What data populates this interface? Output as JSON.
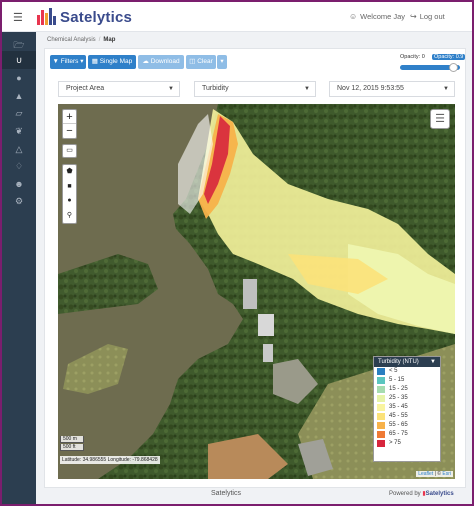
{
  "app": {
    "brand": "Satelytics",
    "brand_colors": [
      "#e8364f",
      "#f0a030",
      "#3a4b8c"
    ]
  },
  "header": {
    "welcome": "Welcome Jay",
    "logout": "Log out"
  },
  "sidebar": {
    "items": [
      {
        "icon": "folder-icon"
      },
      {
        "icon": "magnet-icon",
        "active": true
      },
      {
        "icon": "drop-icon"
      },
      {
        "icon": "warning-icon"
      },
      {
        "icon": "flask-icon"
      },
      {
        "icon": "leaf-icon"
      },
      {
        "icon": "fire-icon"
      },
      {
        "icon": "bell-icon"
      },
      {
        "icon": "user-icon"
      },
      {
        "icon": "cogs-icon"
      }
    ]
  },
  "breadcrumb": {
    "parent": "Chemical Analysis",
    "separator": "/",
    "current": "Map"
  },
  "toolbar": {
    "filters": "Filters",
    "single_map": "Single Map",
    "download": "Download",
    "clear": "Clear",
    "opacity_label": "Opacity: 0",
    "opacity_value_label": "Opacity: 0.9",
    "opacity_value": 0.9
  },
  "selectors": {
    "project_area": "Project Area",
    "parameter": "Turbidity",
    "date": "Nov 12, 2015 9:53:55"
  },
  "map": {
    "zoom_in": "+",
    "zoom_out": "−",
    "scale_m": "500 m",
    "scale_ft": "500 ft",
    "coordinates": "Latitude: 34.986555 Longitude: -79.868428",
    "attribution_leaflet": "Leaflet",
    "attribution_sep": " | © ",
    "attribution_esri": "Esri"
  },
  "legend": {
    "title": "Turbidity (NTU)",
    "items": [
      {
        "label": "< 5",
        "color": "#2a7fc1"
      },
      {
        "label": "5 - 15",
        "color": "#5cc6c0"
      },
      {
        "label": "15 - 25",
        "color": "#a6dcb0"
      },
      {
        "label": "25 - 35",
        "color": "#e7f4a8"
      },
      {
        "label": "35 - 45",
        "color": "#f9f4a0"
      },
      {
        "label": "45 - 55",
        "color": "#fbe27a"
      },
      {
        "label": "55 - 65",
        "color": "#f7b24a"
      },
      {
        "label": "65 - 75",
        "color": "#ef7a35"
      },
      {
        "label": "> 75",
        "color": "#d7263d"
      }
    ]
  },
  "footer": {
    "center": "Satelytics",
    "powered_by": "Powered by",
    "brand": "Satelytics"
  }
}
